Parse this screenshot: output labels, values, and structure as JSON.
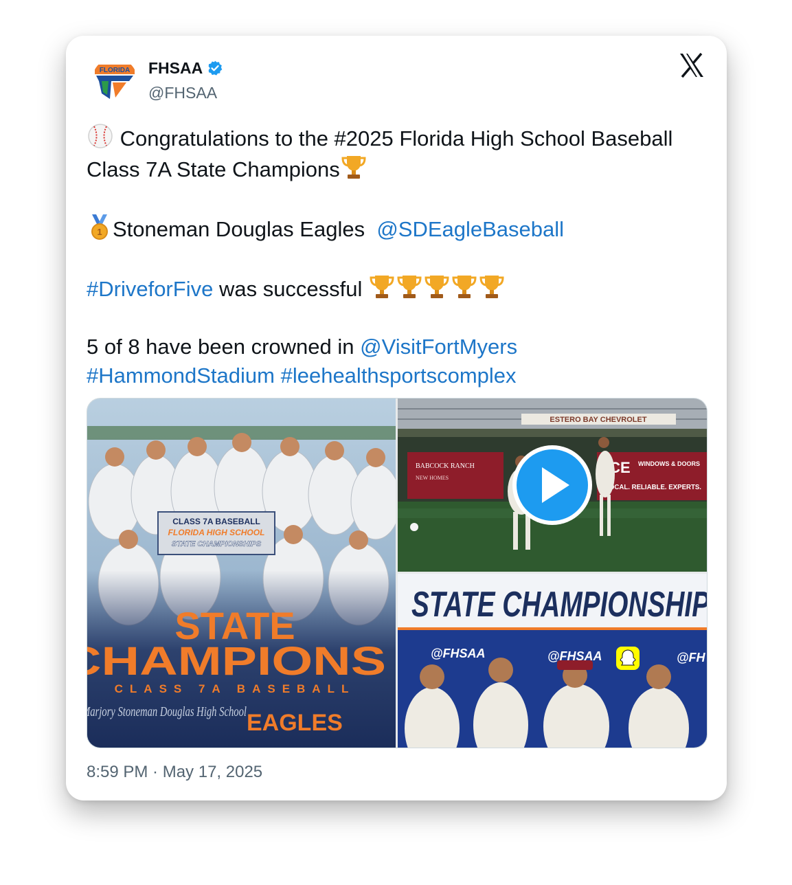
{
  "author": {
    "display_name": "FHSAA",
    "handle": "@FHSAA",
    "avatar_logo_text": "FLORIDA",
    "avatar_icon": "fhsaa-logo-icon",
    "verified_icon": "verified-badge-icon"
  },
  "platform": {
    "logo_icon": "x-logo-icon"
  },
  "tweet": {
    "line1_before": "Congratulations to the #2025 Florida High School Baseball Class 7A State Champions",
    "line2_team": "Stoneman Douglas Eagles",
    "line2_mention": "@SDEagleBaseball",
    "line3_hashtag": "#DriveforFive",
    "line3_text": "was successful",
    "line4_text": "5 of 8 have been crowned in",
    "line4_mention": "@VisitFortMyers",
    "line5_hashtag1": "#HammondStadium",
    "line5_hashtag2": "#leehealthsportscomplex"
  },
  "media": {
    "photo1": {
      "banner_line1": "CLASS 7A BASEBALL",
      "banner_line2": "FLORIDA HIGH SCHOOL",
      "banner_line3": "STATE CHAMPIONSHIPS",
      "headline1": "STATE",
      "headline2": "CHAMPIONS",
      "subline": "CLASS 7A BASEBALL",
      "school": "Marjory Stoneman Douglas High School",
      "team": "EAGLES"
    },
    "video": {
      "sign_top": "ESTERO BAY CHEVROLET",
      "sign_left_title": "BABCOCK RANCH",
      "sign_left_sub": "NEW HOMES",
      "sign_right_title": "ICE",
      "sign_right_sub": "WINDOWS & DOORS",
      "sign_right_tag": "LOCAL. RELIABLE. EXPERTS.",
      "play_icon": "play-icon"
    },
    "photo3": {
      "banner": "STATE CHAMPIONSHIPS",
      "handle1": "@FHSAA",
      "handle2": "@FHSAA",
      "handle3": "@FH"
    }
  },
  "timestamp": "8:59 PM · May 17, 2025",
  "colors": {
    "link": "#1d76c8",
    "verified": "#1d9bf0",
    "orange": "#f07c2a"
  }
}
